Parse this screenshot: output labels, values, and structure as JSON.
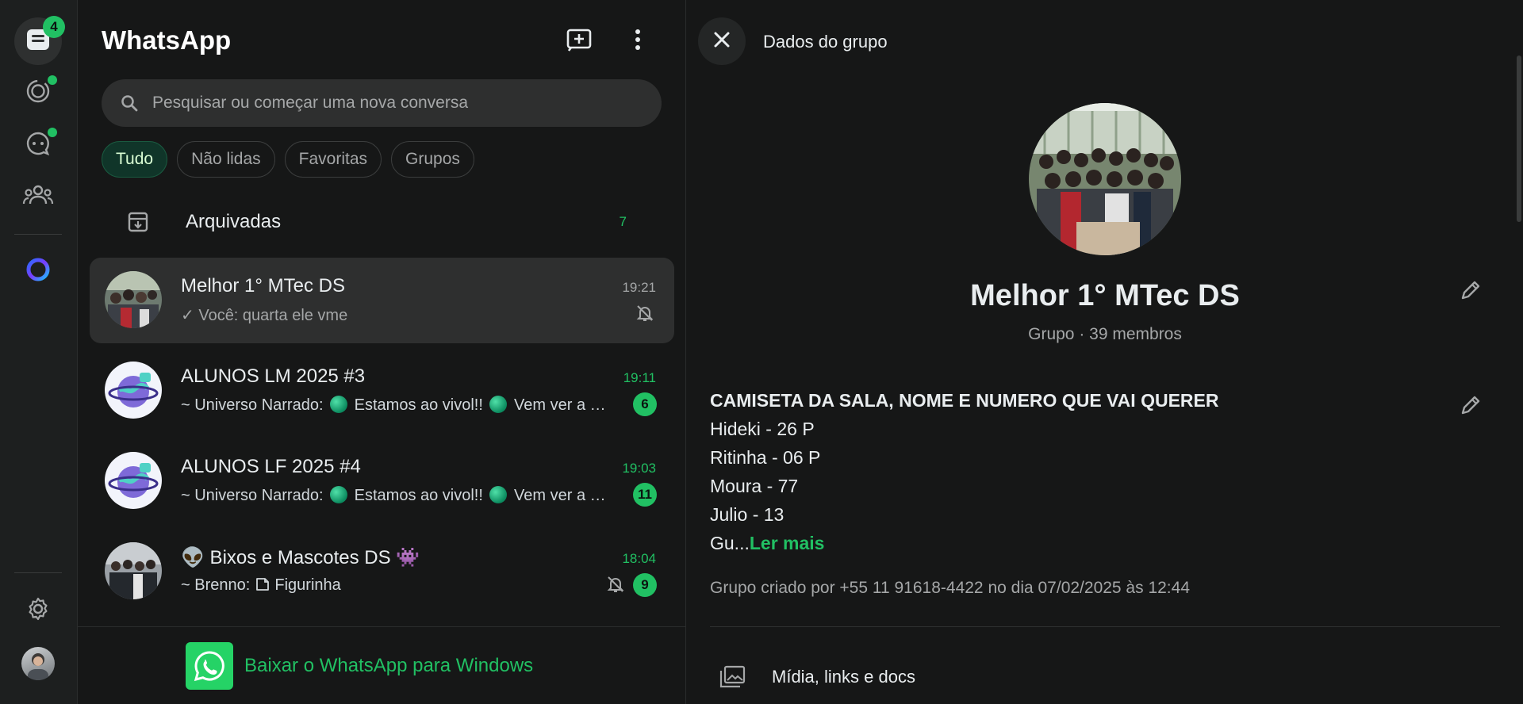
{
  "colors": {
    "accent": "#21c063",
    "background": "#161717",
    "panel": "#1d1f1f",
    "selected": "#2e2f2f"
  },
  "rail": {
    "chats_badge": "4",
    "items": [
      {
        "name": "chats-icon"
      },
      {
        "name": "status-icon"
      },
      {
        "name": "channels-icon"
      },
      {
        "name": "communities-icon"
      },
      {
        "name": "meta-ai-icon"
      },
      {
        "name": "settings-icon"
      }
    ]
  },
  "app": {
    "title": "WhatsApp"
  },
  "search": {
    "placeholder": "Pesquisar ou começar uma nova conversa"
  },
  "filters": {
    "all": "Tudo",
    "unread": "Não lidas",
    "favorites": "Favoritas",
    "groups": "Grupos"
  },
  "archived": {
    "label": "Arquivadas",
    "count": "7"
  },
  "chats": [
    {
      "name": "Melhor 1° MTec DS",
      "time": "19:21",
      "preview": "Você: quarta ele vme",
      "muted": true,
      "selected": true
    },
    {
      "name": "ALUNOS LM 2025 #3",
      "time": "19:11",
      "preview_prefix": "~ Universo Narrado: ",
      "preview_mid": " Estamos ao vivol!! ",
      "preview_end": " Vem ver a …",
      "unread": "6"
    },
    {
      "name": "ALUNOS LF 2025 #4",
      "time": "19:03",
      "preview_prefix": "~ Universo Narrado: ",
      "preview_mid": " Estamos ao vivol!! ",
      "preview_end": " Vem ver a …",
      "unread": "11"
    },
    {
      "name_prefix": "👽",
      "name": " Bixos e Mascotes DS ",
      "name_suffix": "👾",
      "time": "18:04",
      "preview_prefix": "~ Brenno: ",
      "preview_end": " Figurinha",
      "unread": "9",
      "muted": true
    }
  ],
  "download": {
    "label": "Baixar o WhatsApp para Windows"
  },
  "info": {
    "title": "Dados do grupo",
    "group_name": "Melhor 1° MTec DS",
    "group_sub": "Grupo · 39 membros",
    "description_heading": "CAMISETA DA SALA, NOME E NUMERO QUE VAI QUERER",
    "description_lines": [
      "Hideki - 26 P",
      "Ritinha - 06 P",
      "Moura - 77",
      "Julio - 13"
    ],
    "description_truncated": "Gu...",
    "read_more": "Ler mais",
    "created": "Grupo criado por +55 11 91618-4422 no dia 07/02/2025 às 12:44",
    "media_label": "Mídia, links e docs"
  }
}
